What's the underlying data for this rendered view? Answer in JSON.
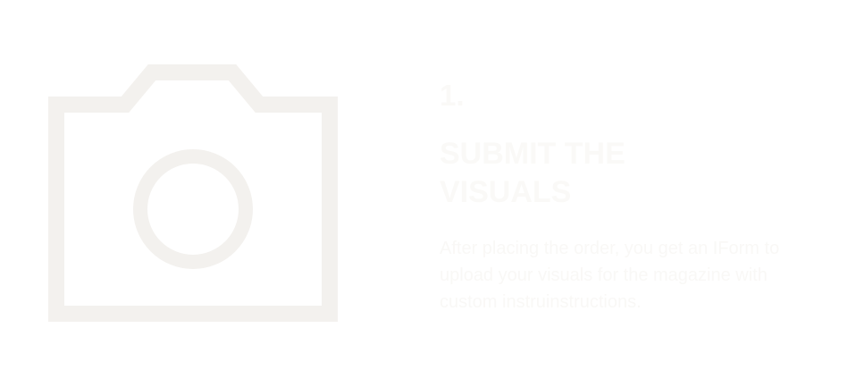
{
  "colors": {
    "background": "#ffffff",
    "icon": "#f3f1ee",
    "heading": "#faf9f7",
    "text": "#f9f8f6"
  },
  "step": {
    "icon": "camera-icon",
    "number": "1.",
    "title_lines": [
      "SUBMIT THE",
      "VISUALS"
    ],
    "description": "After placing the order, you get an IForm to upload your visuals for the magazine with custom instruinstructions."
  }
}
